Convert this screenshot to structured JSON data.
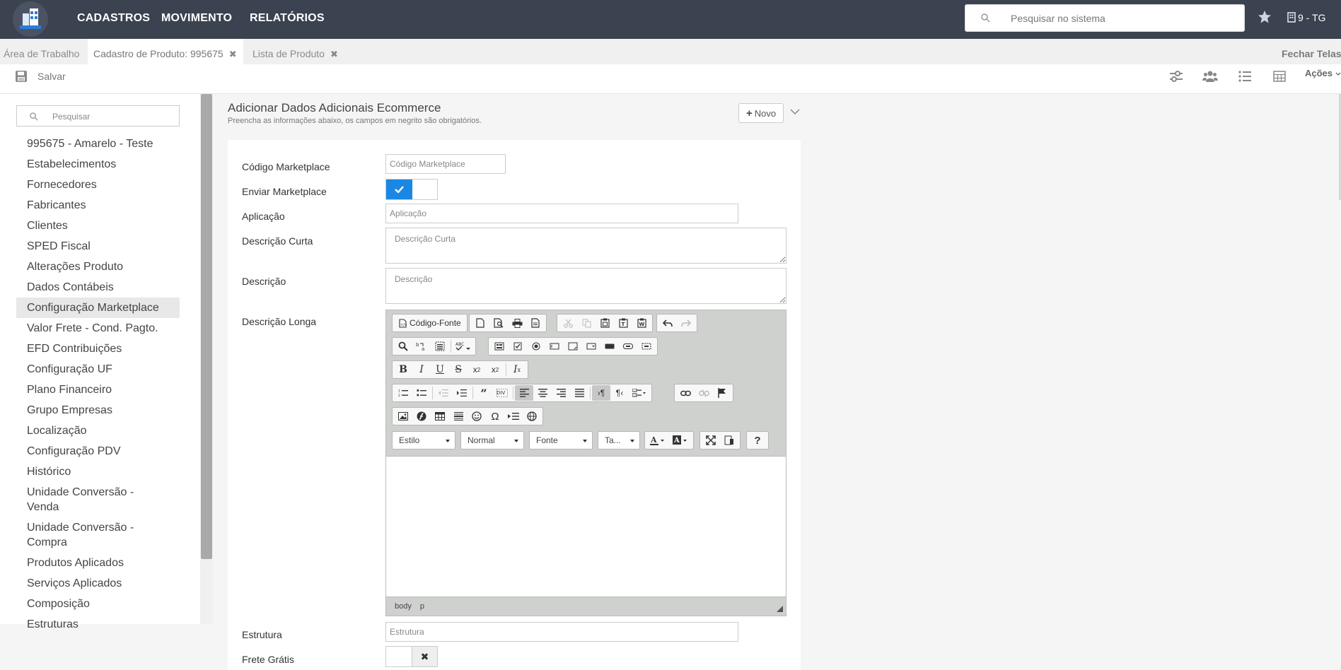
{
  "topbar": {
    "menu": [
      "CADASTROS",
      "MOVIMENTO",
      "RELATÓRIOS"
    ],
    "search_placeholder": "Pesquisar no sistema",
    "company": "9 - TG"
  },
  "tabs": [
    {
      "label": "Área de Trabalho"
    },
    {
      "label": "Cadastro de Produto: 995675"
    },
    {
      "label": "Lista de Produto"
    }
  ],
  "fechar_label": "Fechar Telas",
  "toolbar": {
    "save_label": "Salvar",
    "acoes_label": "Ações"
  },
  "sidebar": {
    "search_placeholder": "Pesquisar",
    "items": [
      "995675 - Amarelo - Teste",
      "Estabelecimentos",
      "Fornecedores",
      "Fabricantes",
      "Clientes",
      "SPED Fiscal",
      "Alterações Produto",
      "Dados Contábeis",
      "Configuração Marketplace",
      "Valor Frete - Cond. Pagto.",
      "EFD Contribuições",
      "Configuração UF",
      "Plano Financeiro",
      "Grupo Empresas",
      "Localização",
      "Configuração PDV",
      "Histórico",
      "Unidade Conversão - Venda",
      "Unidade Conversão - Compra",
      "Produtos Aplicados",
      "Serviços Aplicados",
      "Composição",
      "Estruturas"
    ],
    "active_item": "Configuração Marketplace"
  },
  "main": {
    "title": "Adicionar Dados Adicionais Ecommerce",
    "subtitle": "Preencha as informações abaixo, os campos em negrito são obrigatórios.",
    "novo_label": "Novo"
  },
  "form": {
    "codigo_marketplace": {
      "label": "Código Marketplace",
      "placeholder": "Código Marketplace",
      "value": ""
    },
    "enviar_marketplace": {
      "label": "Enviar Marketplace",
      "checked": true
    },
    "aplicacao": {
      "label": "Aplicação",
      "placeholder": "Aplicação",
      "value": ""
    },
    "descricao_curta": {
      "label": "Descrição Curta",
      "placeholder": "Descrição Curta",
      "value": ""
    },
    "descricao": {
      "label": "Descrição",
      "placeholder": "Descrição",
      "value": ""
    },
    "descricao_longa": {
      "label": "Descrição Longa"
    },
    "estrutura": {
      "label": "Estrutura",
      "placeholder": "Estrutura",
      "value": ""
    },
    "frete_gratis": {
      "label": "Frete Grátis",
      "checked": false
    }
  },
  "editor": {
    "source_label": "Código-Fonte",
    "combos": {
      "style": "Estilo",
      "format": "Normal",
      "font": "Fonte",
      "size": "Ta..."
    },
    "status_path": [
      "body",
      "p"
    ]
  },
  "colors": {
    "topbar": "#3b4250",
    "accent": "#1a87e5",
    "active_sidebar": "#e8e8e8"
  }
}
